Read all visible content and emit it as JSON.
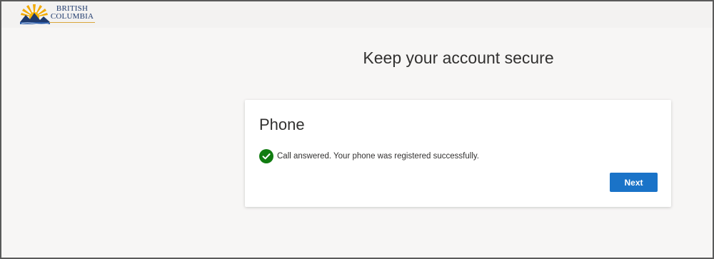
{
  "header": {
    "logo": {
      "line1": "BRITISH",
      "line2": "COLUMBIA",
      "icon": "bc-sun-mountain-logo"
    }
  },
  "main": {
    "title": "Keep your account secure",
    "card": {
      "title": "Phone",
      "status_icon": "check-circle-icon",
      "status_text": "Call answered. Your phone was registered successfully.",
      "next_label": "Next"
    }
  },
  "colors": {
    "accent": "#1a73c8",
    "success": "#107c10",
    "logo_blue": "#1f3a6d",
    "logo_gold": "#f2a900"
  }
}
